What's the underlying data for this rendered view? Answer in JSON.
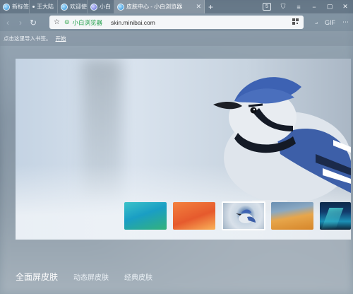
{
  "tabs": [
    {
      "label": "新标签",
      "icon": "browser-logo-icon",
      "active": false
    },
    {
      "label": "王大陆",
      "icon": "dot-icon",
      "active": false
    },
    {
      "label": "欢迎使",
      "icon": "browser-logo-icon",
      "active": false
    },
    {
      "label": "小白",
      "icon": "browser-logo-icon",
      "active": false
    },
    {
      "label": "皮肤中心 - 小白浏览器",
      "icon": "browser-logo-icon",
      "active": true
    }
  ],
  "new_tab_symbol": "+",
  "window_controls": {
    "badge": "5",
    "shield": "⛉",
    "menu": "≡",
    "minimize": "−",
    "restore": "▢",
    "close": "✕"
  },
  "address_bar": {
    "site_name": "小白浏览器",
    "url": "skin.minibai.com"
  },
  "toolbar_right": {
    "crop": "⟓",
    "gif": "GIF",
    "more": "⋯"
  },
  "bookmark_bar": {
    "hint": "点击这里导入书签。",
    "action": "开始"
  },
  "thumbnails": [
    {
      "name": "underwater",
      "selected": false
    },
    {
      "name": "orange-stage",
      "selected": false
    },
    {
      "name": "blue-jay",
      "selected": true
    },
    {
      "name": "desert-sunset",
      "selected": false
    },
    {
      "name": "aurora",
      "selected": false
    }
  ],
  "skin_tabs": [
    {
      "label": "全面屏皮肤",
      "active": true
    },
    {
      "label": "动态屏皮肤",
      "active": false
    },
    {
      "label": "经典皮肤",
      "active": false
    }
  ],
  "colors": {
    "accent_green": "#1fa04a",
    "bird_blue": "#3d5fa8"
  }
}
